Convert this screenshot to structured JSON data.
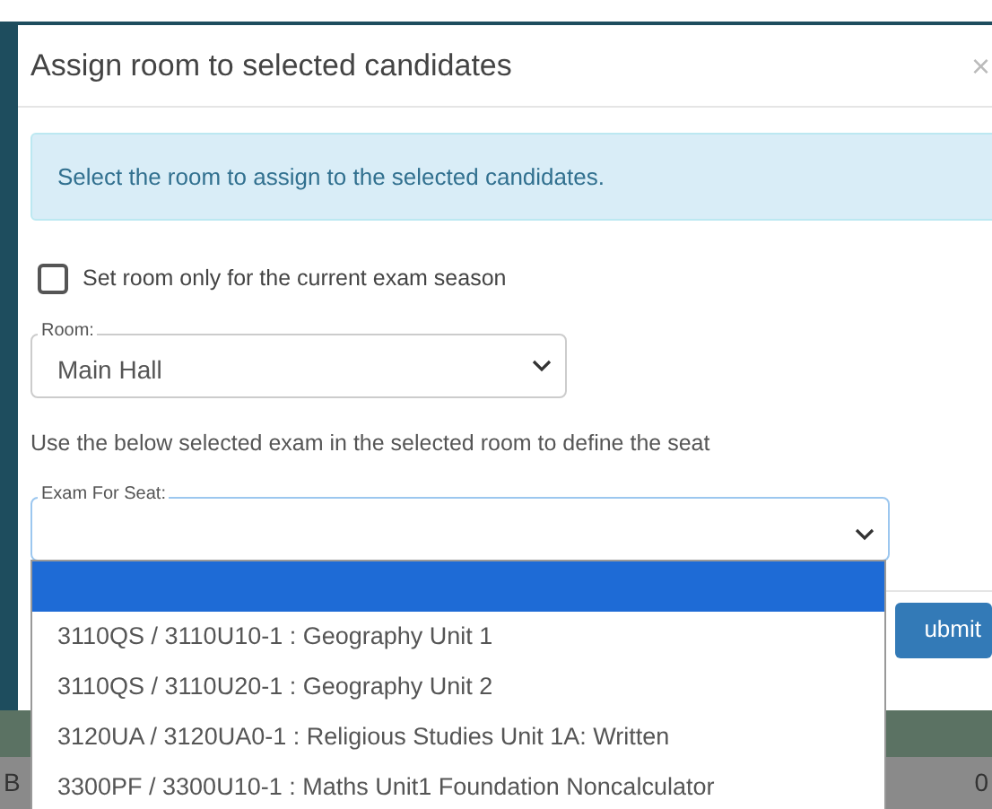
{
  "background": {
    "left_text": "B",
    "right_text": "0"
  },
  "dialog": {
    "title": "Assign room to selected candidates",
    "close": "×",
    "alert": "Select the room to assign to the selected candidates.",
    "season_checkbox": {
      "label": "Set room only for the current exam season",
      "checked": false
    },
    "room": {
      "label": "Room:",
      "value": "Main Hall"
    },
    "instruction": "Use the below selected exam in the selected room to define the seat",
    "exam_for_seat": {
      "label": "Exam For Seat:",
      "open": true,
      "options": [
        {
          "selected": true
        },
        {
          "text": "3110QS / 3110U10-1 : Geography Unit 1",
          "selected": false
        },
        {
          "text": "3110QS / 3110U20-1 : Geography Unit 2",
          "selected": false
        },
        {
          "text": "3120UA / 3120UA0-1 : Religious Studies Unit 1A: Written",
          "selected": false
        },
        {
          "text": "3300PF / 3300U10-1 : Maths Unit1 Foundation Noncalculator",
          "selected": false
        }
      ]
    },
    "submit_button": "ubmit"
  }
}
